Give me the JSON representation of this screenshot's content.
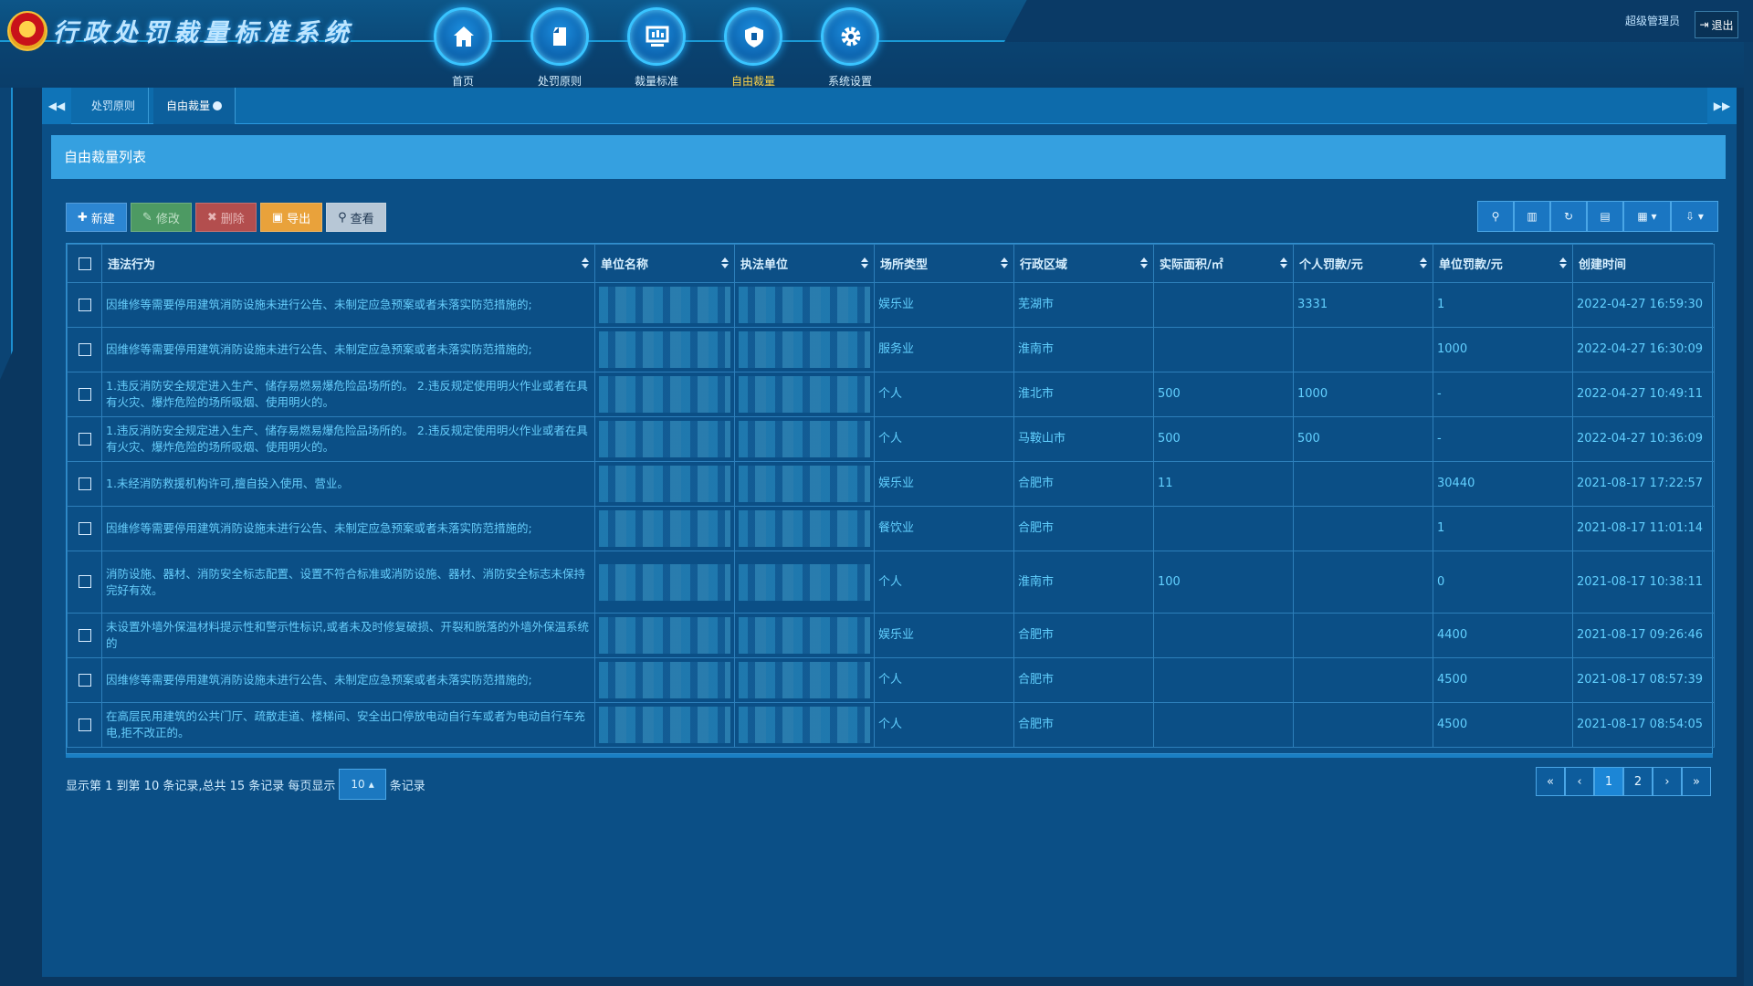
{
  "app": {
    "title": "行政处罚裁量标准系统"
  },
  "nav": [
    {
      "label": "首页",
      "icon": "home-icon"
    },
    {
      "label": "处罚原则",
      "icon": "document-icon"
    },
    {
      "label": "裁量标准",
      "icon": "monitor-icon"
    },
    {
      "label": "自由裁量",
      "icon": "shield-icon"
    },
    {
      "label": "系统设置",
      "icon": "gear-icon"
    }
  ],
  "user": {
    "name": "超级管理员",
    "logout": "退出"
  },
  "tabs": [
    {
      "label": "处罚原则"
    },
    {
      "label": "自由裁量"
    }
  ],
  "panel": {
    "title": "自由裁量列表"
  },
  "toolbar": {
    "new": "新建",
    "edit": "修改",
    "delete": "删除",
    "export": "导出",
    "view": "查看"
  },
  "table": {
    "headers": [
      "违法行为",
      "单位名称",
      "执法单位",
      "场所类型",
      "行政区域",
      "实际面积/㎡",
      "个人罚款/元",
      "单位罚款/元",
      "创建时间"
    ],
    "rows": [
      {
        "violation": "因维修等需要停用建筑消防设施未进行公告、未制定应急预案或者未落实防范措施的;",
        "type": "娱乐业",
        "region": "芜湖市",
        "area": "",
        "personal": "3331",
        "unit": "1",
        "time": "2022-04-27 16:59:30"
      },
      {
        "violation": "因维修等需要停用建筑消防设施未进行公告、未制定应急预案或者未落实防范措施的;",
        "type": "服务业",
        "region": "淮南市",
        "area": "",
        "personal": "",
        "unit": "1000",
        "time": "2022-04-27 16:30:09"
      },
      {
        "violation": "1.违反消防安全规定进入生产、储存易燃易爆危险品场所的。 2.违反规定使用明火作业或者在具有火灾、爆炸危险的场所吸烟、使用明火的。",
        "type": "个人",
        "region": "淮北市",
        "area": "500",
        "personal": "1000",
        "unit": "-",
        "time": "2022-04-27 10:49:11"
      },
      {
        "violation": "1.违反消防安全规定进入生产、储存易燃易爆危险品场所的。 2.违反规定使用明火作业或者在具有火灾、爆炸危险的场所吸烟、使用明火的。",
        "type": "个人",
        "region": "马鞍山市",
        "area": "500",
        "personal": "500",
        "unit": "-",
        "time": "2022-04-27 10:36:09"
      },
      {
        "violation": "1.未经消防救援机构许可,擅自投入使用、营业。",
        "type": "娱乐业",
        "region": "合肥市",
        "area": "11",
        "personal": "",
        "unit": "30440",
        "time": "2021-08-17 17:22:57"
      },
      {
        "violation": "因维修等需要停用建筑消防设施未进行公告、未制定应急预案或者未落实防范措施的;",
        "type": "餐饮业",
        "region": "合肥市",
        "area": "",
        "personal": "",
        "unit": "1",
        "time": "2021-08-17 11:01:14"
      },
      {
        "violation": "消防设施、器材、消防安全标志配置、设置不符合标准或消防设施、器材、消防安全标志未保持完好有效。",
        "type": "个人",
        "region": "淮南市",
        "area": "100",
        "personal": "",
        "unit": "0",
        "time": "2021-08-17 10:38:11"
      },
      {
        "violation": "未设置外墙外保温材料提示性和警示性标识,或者未及时修复破损、开裂和脱落的外墙外保温系统的",
        "type": "娱乐业",
        "region": "合肥市",
        "area": "",
        "personal": "",
        "unit": "4400",
        "time": "2021-08-17 09:26:46"
      },
      {
        "violation": "因维修等需要停用建筑消防设施未进行公告、未制定应急预案或者未落实防范措施的;",
        "type": "个人",
        "region": "合肥市",
        "area": "",
        "personal": "",
        "unit": "4500",
        "time": "2021-08-17 08:57:39"
      },
      {
        "violation": "在高层民用建筑的公共门厅、疏散走道、楼梯间、安全出口停放电动自行车或者为电动自行车充电,拒不改正的。",
        "type": "个人",
        "region": "合肥市",
        "area": "",
        "personal": "",
        "unit": "4500",
        "time": "2021-08-17 08:54:05"
      }
    ]
  },
  "pagination": {
    "info_prefix": "显示第 1 到第 10 条记录,总共 15 条记录 每页显示",
    "page_size": "10",
    "info_suffix": "条记录",
    "first": "«",
    "prev": "‹",
    "pages": [
      "1",
      "2"
    ],
    "next": "›",
    "last": "»",
    "current": "1"
  },
  "colors": {
    "accent": "#35a0e0",
    "active_nav": "#ffd54a",
    "cell_text": "#62d0ff"
  }
}
